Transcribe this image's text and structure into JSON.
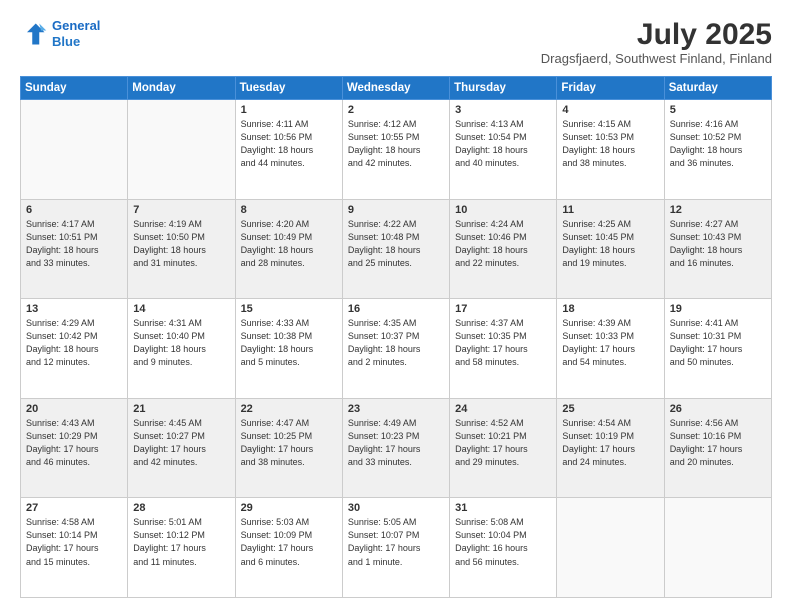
{
  "header": {
    "logo_line1": "General",
    "logo_line2": "Blue",
    "month": "July 2025",
    "location": "Dragsfjaerd, Southwest Finland, Finland"
  },
  "weekdays": [
    "Sunday",
    "Monday",
    "Tuesday",
    "Wednesday",
    "Thursday",
    "Friday",
    "Saturday"
  ],
  "weeks": [
    [
      {
        "day": "",
        "info": ""
      },
      {
        "day": "",
        "info": ""
      },
      {
        "day": "1",
        "info": "Sunrise: 4:11 AM\nSunset: 10:56 PM\nDaylight: 18 hours\nand 44 minutes."
      },
      {
        "day": "2",
        "info": "Sunrise: 4:12 AM\nSunset: 10:55 PM\nDaylight: 18 hours\nand 42 minutes."
      },
      {
        "day": "3",
        "info": "Sunrise: 4:13 AM\nSunset: 10:54 PM\nDaylight: 18 hours\nand 40 minutes."
      },
      {
        "day": "4",
        "info": "Sunrise: 4:15 AM\nSunset: 10:53 PM\nDaylight: 18 hours\nand 38 minutes."
      },
      {
        "day": "5",
        "info": "Sunrise: 4:16 AM\nSunset: 10:52 PM\nDaylight: 18 hours\nand 36 minutes."
      }
    ],
    [
      {
        "day": "6",
        "info": "Sunrise: 4:17 AM\nSunset: 10:51 PM\nDaylight: 18 hours\nand 33 minutes."
      },
      {
        "day": "7",
        "info": "Sunrise: 4:19 AM\nSunset: 10:50 PM\nDaylight: 18 hours\nand 31 minutes."
      },
      {
        "day": "8",
        "info": "Sunrise: 4:20 AM\nSunset: 10:49 PM\nDaylight: 18 hours\nand 28 minutes."
      },
      {
        "day": "9",
        "info": "Sunrise: 4:22 AM\nSunset: 10:48 PM\nDaylight: 18 hours\nand 25 minutes."
      },
      {
        "day": "10",
        "info": "Sunrise: 4:24 AM\nSunset: 10:46 PM\nDaylight: 18 hours\nand 22 minutes."
      },
      {
        "day": "11",
        "info": "Sunrise: 4:25 AM\nSunset: 10:45 PM\nDaylight: 18 hours\nand 19 minutes."
      },
      {
        "day": "12",
        "info": "Sunrise: 4:27 AM\nSunset: 10:43 PM\nDaylight: 18 hours\nand 16 minutes."
      }
    ],
    [
      {
        "day": "13",
        "info": "Sunrise: 4:29 AM\nSunset: 10:42 PM\nDaylight: 18 hours\nand 12 minutes."
      },
      {
        "day": "14",
        "info": "Sunrise: 4:31 AM\nSunset: 10:40 PM\nDaylight: 18 hours\nand 9 minutes."
      },
      {
        "day": "15",
        "info": "Sunrise: 4:33 AM\nSunset: 10:38 PM\nDaylight: 18 hours\nand 5 minutes."
      },
      {
        "day": "16",
        "info": "Sunrise: 4:35 AM\nSunset: 10:37 PM\nDaylight: 18 hours\nand 2 minutes."
      },
      {
        "day": "17",
        "info": "Sunrise: 4:37 AM\nSunset: 10:35 PM\nDaylight: 17 hours\nand 58 minutes."
      },
      {
        "day": "18",
        "info": "Sunrise: 4:39 AM\nSunset: 10:33 PM\nDaylight: 17 hours\nand 54 minutes."
      },
      {
        "day": "19",
        "info": "Sunrise: 4:41 AM\nSunset: 10:31 PM\nDaylight: 17 hours\nand 50 minutes."
      }
    ],
    [
      {
        "day": "20",
        "info": "Sunrise: 4:43 AM\nSunset: 10:29 PM\nDaylight: 17 hours\nand 46 minutes."
      },
      {
        "day": "21",
        "info": "Sunrise: 4:45 AM\nSunset: 10:27 PM\nDaylight: 17 hours\nand 42 minutes."
      },
      {
        "day": "22",
        "info": "Sunrise: 4:47 AM\nSunset: 10:25 PM\nDaylight: 17 hours\nand 38 minutes."
      },
      {
        "day": "23",
        "info": "Sunrise: 4:49 AM\nSunset: 10:23 PM\nDaylight: 17 hours\nand 33 minutes."
      },
      {
        "day": "24",
        "info": "Sunrise: 4:52 AM\nSunset: 10:21 PM\nDaylight: 17 hours\nand 29 minutes."
      },
      {
        "day": "25",
        "info": "Sunrise: 4:54 AM\nSunset: 10:19 PM\nDaylight: 17 hours\nand 24 minutes."
      },
      {
        "day": "26",
        "info": "Sunrise: 4:56 AM\nSunset: 10:16 PM\nDaylight: 17 hours\nand 20 minutes."
      }
    ],
    [
      {
        "day": "27",
        "info": "Sunrise: 4:58 AM\nSunset: 10:14 PM\nDaylight: 17 hours\nand 15 minutes."
      },
      {
        "day": "28",
        "info": "Sunrise: 5:01 AM\nSunset: 10:12 PM\nDaylight: 17 hours\nand 11 minutes."
      },
      {
        "day": "29",
        "info": "Sunrise: 5:03 AM\nSunset: 10:09 PM\nDaylight: 17 hours\nand 6 minutes."
      },
      {
        "day": "30",
        "info": "Sunrise: 5:05 AM\nSunset: 10:07 PM\nDaylight: 17 hours\nand 1 minute."
      },
      {
        "day": "31",
        "info": "Sunrise: 5:08 AM\nSunset: 10:04 PM\nDaylight: 16 hours\nand 56 minutes."
      },
      {
        "day": "",
        "info": ""
      },
      {
        "day": "",
        "info": ""
      }
    ]
  ]
}
